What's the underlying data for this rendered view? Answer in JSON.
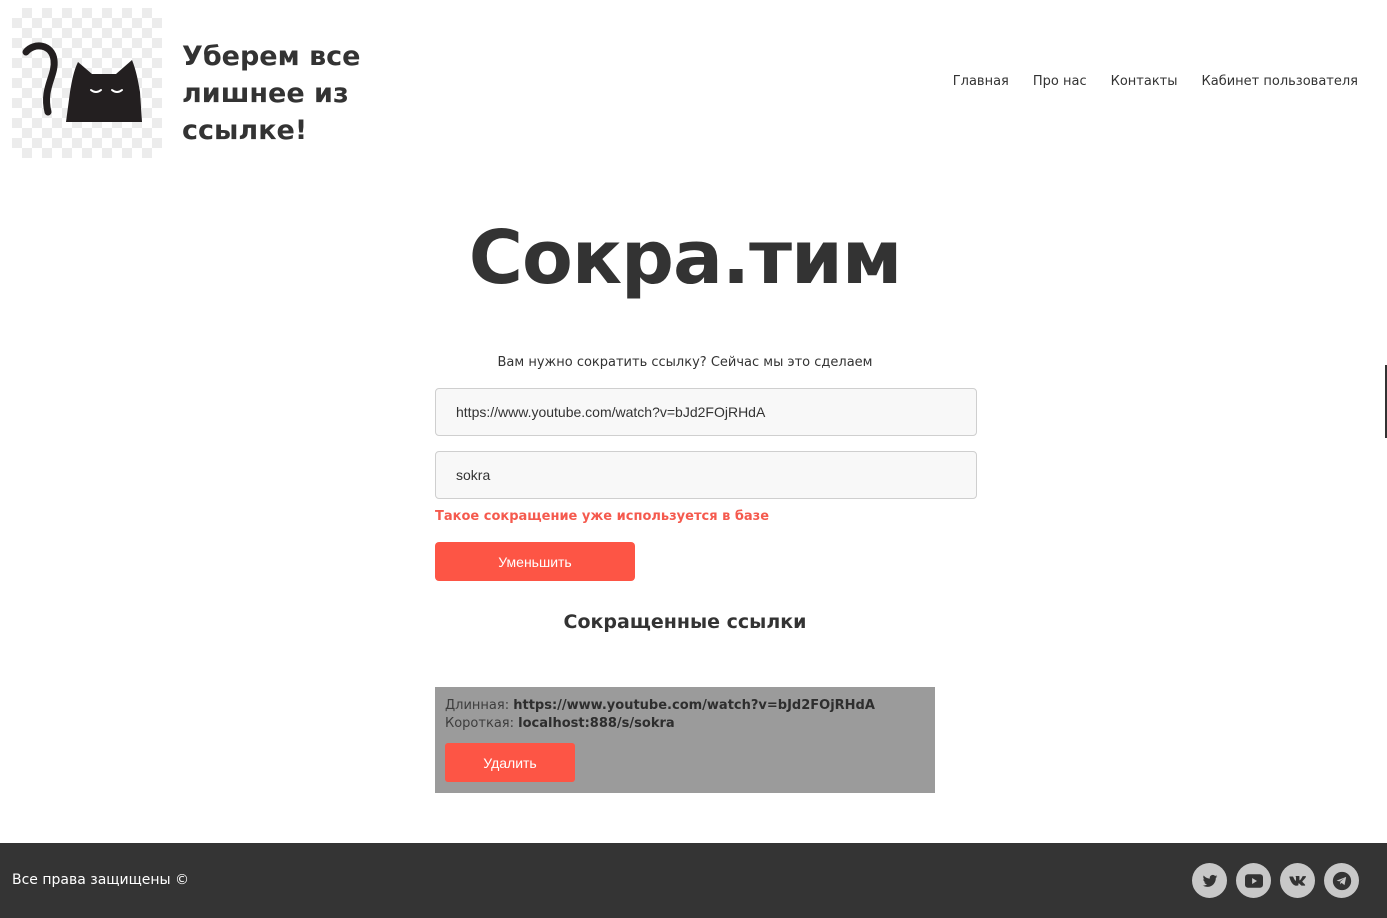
{
  "header": {
    "tagline_line1": "Уберем все",
    "tagline_line2": "лишнее из",
    "tagline_line3": "ссылке!",
    "logo_icon": "black-cat-icon",
    "nav": [
      {
        "label": "Главная"
      },
      {
        "label": "Про нас"
      },
      {
        "label": "Контакты"
      },
      {
        "label": "Кабинет пользователя"
      }
    ]
  },
  "hero": {
    "brand": "Сокра.тим",
    "subtitle": "Вам нужно сократить ссылку? Сейчас мы это сделаем"
  },
  "form": {
    "url_value": "https://www.youtube.com/watch?v=bJd2FOjRHdA",
    "alias_value": "sokra",
    "error_text": "Такое сокращение уже используется в базе",
    "submit_label": "Уменьшить"
  },
  "links_section": {
    "title": "Сокращенные ссылки",
    "items": [
      {
        "long_label": "Длинная:",
        "long_value": "https://www.youtube.com/watch?v=bJd2FOjRHdA",
        "short_label": "Короткая:",
        "short_value": "localhost:888/s/sokra",
        "delete_label": "Удалить"
      }
    ]
  },
  "footer": {
    "copyright": "Все права защищены ©",
    "socials": [
      {
        "icon": "twitter-icon"
      },
      {
        "icon": "youtube-icon"
      },
      {
        "icon": "vk-icon"
      },
      {
        "icon": "telegram-icon"
      }
    ]
  },
  "colors": {
    "accent": "#fd5545",
    "error": "#f55a4e",
    "text": "#333333",
    "card_bg": "#9b9b9b",
    "footer_bg": "#343434",
    "social_bg": "#c8c8c8"
  }
}
